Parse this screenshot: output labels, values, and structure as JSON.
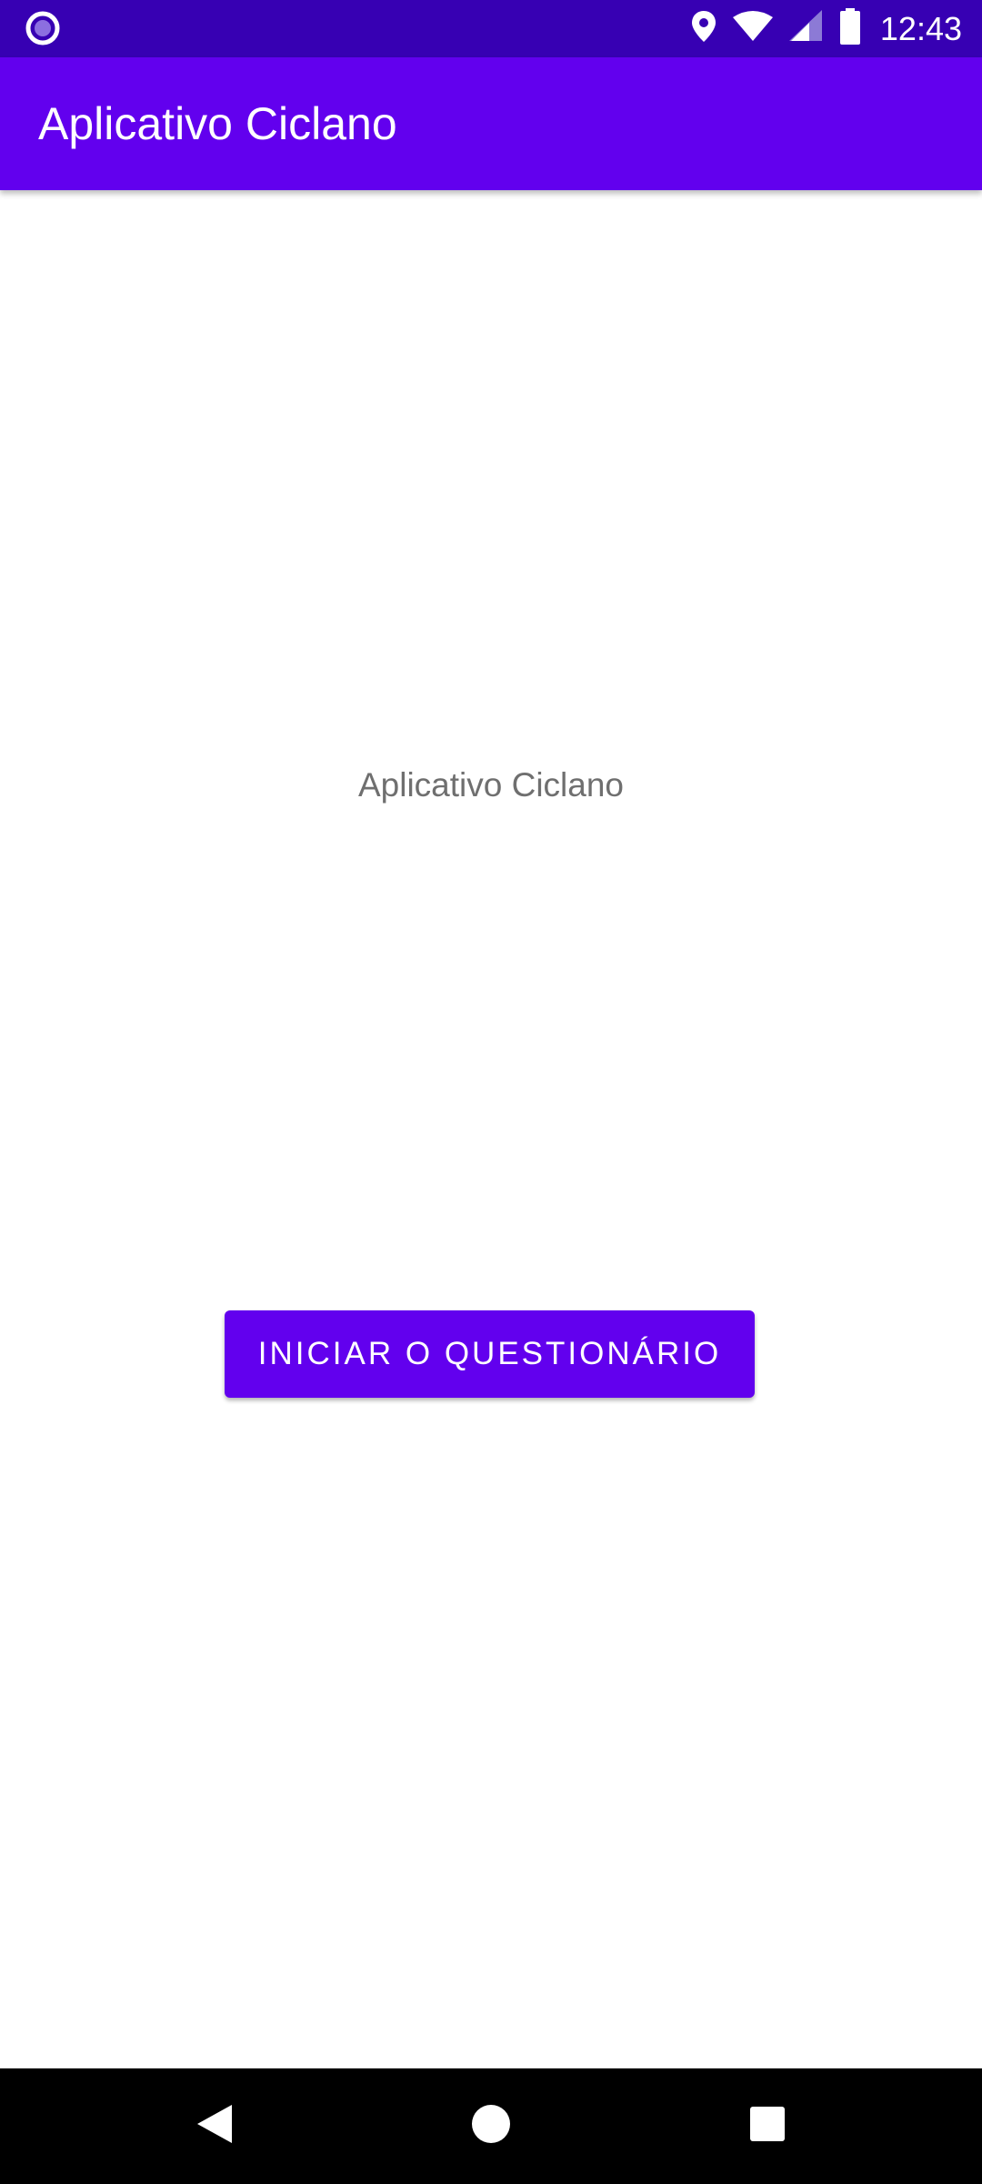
{
  "status_bar": {
    "time": "12:43",
    "icons": [
      "notification-dot-icon",
      "location-icon",
      "wifi-icon",
      "cell-signal-icon",
      "battery-icon"
    ],
    "background": "#3700B3"
  },
  "app_bar": {
    "title": "Aplicativo Ciclano",
    "background": "#6200EE"
  },
  "main": {
    "label": "Aplicativo Ciclano",
    "start_button_label": "INICIAR O QUESTIONÁRIO",
    "button_color": "#6200EE"
  },
  "nav_bar": {
    "icons": [
      "back-icon",
      "home-icon",
      "recents-icon"
    ]
  }
}
